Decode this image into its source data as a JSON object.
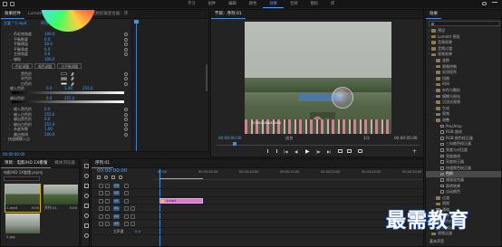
{
  "menubar": {
    "left_icons": [
      "home-icon",
      "import-icon"
    ],
    "workspaces": [
      "学习",
      "组件",
      "编辑",
      "颜色",
      "效果",
      "音频",
      "图形",
      "库"
    ],
    "active_workspace": "效果",
    "right_icons": [
      "search-icon",
      "window-controls-icon"
    ]
  },
  "effect_controls": {
    "tabs": [
      "效果控件",
      "Lumetri 范围",
      "源：(无剪辑)",
      "音频剪辑混合器：序"
    ],
    "active_tab": "效果控件",
    "source_label": "主要 * 1.mp4",
    "clip_label": "序列 01 * 1.mp4",
    "rows": [
      {
        "label": "色彩饱和度",
        "value": "100.0"
      },
      {
        "label": "平衡数量",
        "value": "0.0"
      },
      {
        "label": "平衡增益",
        "value": "20.0"
      },
      {
        "label": "平衡角度",
        "value": "0.0"
      },
      {
        "label": "主饱和度",
        "value": "0.0"
      }
    ],
    "secondary_label": "辅助",
    "secondary_value": "100.0",
    "preset_buttons": [
      "色阶调整",
      "颜色调整",
      "白平衡调整"
    ],
    "color_rows": [
      {
        "label": "黑色阶"
      },
      {
        "label": "灰色阶"
      },
      {
        "label": "白色阶"
      }
    ],
    "input_levels_label": "输入色阶",
    "input_levels": [
      "0.0",
      "1.00",
      "255.0"
    ],
    "output_levels_label": "输出色阶",
    "output_levels": [
      "0.0",
      "255.0"
    ],
    "lower_rows": [
      {
        "label": "输入黑色阶",
        "value": "0.0"
      },
      {
        "label": "输入白色阶",
        "value": "255.0"
      },
      {
        "label": "输出黑色阶",
        "value": "0.0"
      },
      {
        "label": "输出白色阶",
        "value": "255.0"
      },
      {
        "label": "灰度系数",
        "value": "1.00"
      },
      {
        "label": "输出曲线",
        "value": "100.0"
      }
    ],
    "bottom_section": "快速模糊入点",
    "timecode": "00:00:00:00"
  },
  "program_monitor": {
    "title": "节目：序列 01",
    "timecode_left": "00:00:00:00",
    "fit_label": "适合",
    "quality_label": "1/2",
    "timecode_right": "00:00:05:00",
    "watermark": "©XXIAOXIUXIUXIU"
  },
  "effects_panel": {
    "title": "效果",
    "items": [
      {
        "label": "预设",
        "depth": 0,
        "type": "folder"
      },
      {
        "label": "Lumetri 预设",
        "depth": 0,
        "type": "folder"
      },
      {
        "label": "音频效果",
        "depth": 0,
        "type": "folder"
      },
      {
        "label": "音频过渡",
        "depth": 0,
        "type": "folder"
      },
      {
        "label": "视频效果",
        "depth": 0,
        "type": "folder"
      },
      {
        "label": "变换",
        "depth": 1,
        "type": "folder"
      },
      {
        "label": "图像控制",
        "depth": 1,
        "type": "folder"
      },
      {
        "label": "实用程序",
        "depth": 1,
        "type": "folder"
      },
      {
        "label": "扭曲",
        "depth": 1,
        "type": "folder"
      },
      {
        "label": "时间",
        "depth": 1,
        "type": "folder"
      },
      {
        "label": "杂色与颗粒",
        "depth": 1,
        "type": "folder"
      },
      {
        "label": "模糊与锐化",
        "depth": 1,
        "type": "folder"
      },
      {
        "label": "沉浸式视频",
        "depth": 1,
        "type": "folder"
      },
      {
        "label": "生成",
        "depth": 1,
        "type": "folder"
      },
      {
        "label": "视频",
        "depth": 1,
        "type": "folder"
      },
      {
        "label": "调整",
        "depth": 1,
        "type": "folder"
      },
      {
        "label": "ProcAmp",
        "depth": 2,
        "type": "fx"
      },
      {
        "label": "RGB 曲线",
        "depth": 2,
        "type": "fx"
      },
      {
        "label": "RGB 颜色校正器",
        "depth": 2,
        "type": "fx"
      },
      {
        "label": "三向颜色校正器",
        "depth": 2,
        "type": "fx"
      },
      {
        "label": "亮度与对比度",
        "depth": 2,
        "type": "fx"
      },
      {
        "label": "亮度曲线",
        "depth": 2,
        "type": "fx"
      },
      {
        "label": "亮度校正器",
        "depth": 2,
        "type": "fx"
      },
      {
        "label": "快速颜色校正器",
        "depth": 2,
        "type": "fx"
      },
      {
        "label": "色阶",
        "depth": 2,
        "type": "fx",
        "selected": true
      },
      {
        "label": "通道混合器",
        "depth": 2,
        "type": "fx"
      },
      {
        "label": "照明效果",
        "depth": 2,
        "type": "fx"
      },
      {
        "label": "自动颜色",
        "depth": 2,
        "type": "fx"
      },
      {
        "label": "过渡",
        "depth": 1,
        "type": "folder"
      },
      {
        "label": "透视",
        "depth": 1,
        "type": "folder"
      },
      {
        "label": "通道",
        "depth": 1,
        "type": "folder"
      },
      {
        "label": "键控",
        "depth": 1,
        "type": "folder"
      },
      {
        "label": "颜色校正",
        "depth": 1,
        "type": "folder"
      },
      {
        "label": "风格化",
        "depth": 1,
        "type": "folder"
      },
      {
        "label": "视频过渡",
        "depth": 0,
        "type": "folder"
      }
    ],
    "bottom_label": "基本声音"
  },
  "project_panel": {
    "tabs": [
      "项目：电影/HD 1X看懂",
      "媒体浏览器"
    ],
    "project_name": "电影/HD 1X看懂.prproj",
    "items": [
      {
        "name": "1.mp4",
        "duration": "5:00"
      },
      {
        "name": "序列 01",
        "duration": "5:00"
      },
      {
        "name": "2.jpg",
        "duration": ""
      }
    ]
  },
  "tools": [
    "selection-tool-icon",
    "track-select-icon",
    "ripple-edit-icon",
    "razor-icon",
    "slip-icon",
    "pen-icon",
    "hand-icon",
    "type-icon"
  ],
  "timeline": {
    "title": "序列 01",
    "timecode": "00:00:00:00",
    "ruler_labels": [
      "00:00",
      "00:00:05:00",
      "00:00:10:00",
      "00:00:15:00",
      "00:00:20:00",
      "00:00:25:00",
      "00:00:30:00"
    ],
    "video_tracks": [
      "V3",
      "V2",
      "V1"
    ],
    "audio_tracks": [
      "A1",
      "A2",
      "A3"
    ],
    "master_label": "主声道",
    "master_value": "0.0",
    "clip_label": "1.mp4"
  },
  "watermark_logo": "最需教育"
}
